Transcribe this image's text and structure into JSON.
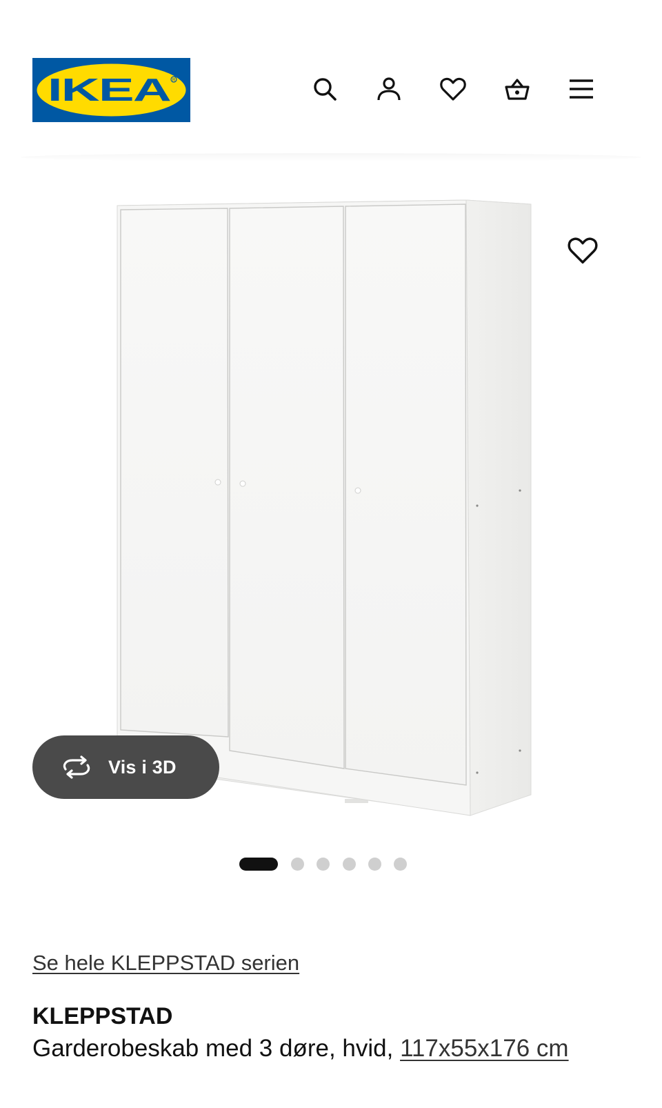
{
  "header": {
    "logo_text": "IKEA",
    "icons": [
      "search-icon",
      "account-icon",
      "heart-icon",
      "basket-icon",
      "menu-icon"
    ]
  },
  "gallery": {
    "button_3d_label": "Vis i 3D",
    "image_count": 6,
    "active_index": 0
  },
  "product": {
    "series_link": "Se hele KLEPPSTAD serien",
    "name": "KLEPPSTAD",
    "description": "Garderobeskab med 3 døre, hvid,",
    "dimensions": "117x55x176 cm"
  },
  "colors": {
    "ikea_blue": "#0058A3",
    "ikea_yellow": "#FFDB00",
    "button_dark": "#4a4a4a",
    "text": "#111111"
  }
}
